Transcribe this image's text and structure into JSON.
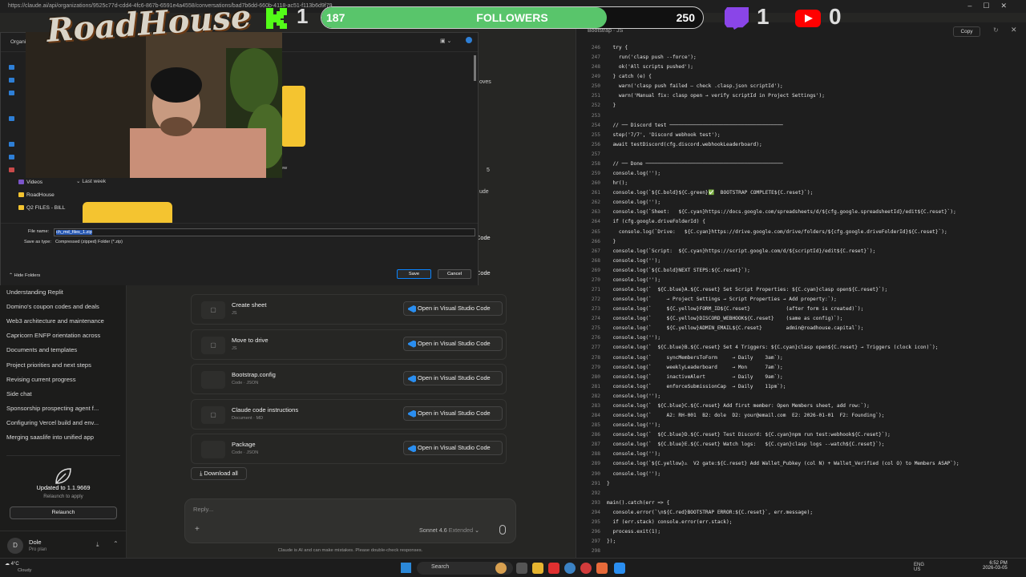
{
  "browser": {
    "url": "https://claude.ai/api/organizations/9525c77d-cdd4-4fc6-867b-6591e4a4558/conversations/bad7b6dd-660b-4118-ac51-f113b6d9f79"
  },
  "overlay": {
    "kick_count": "1",
    "followers_current": "187",
    "followers_label": "FOLLOWERS",
    "followers_goal": "250",
    "followers_progress": 0.748,
    "twitch_count": "1",
    "youtube_count": "0",
    "logo_text": "RoadHouse"
  },
  "dialog": {
    "organize": "Organi",
    "tree": [
      "Videos",
      "RoadHouse",
      "Q2 FILES - BILL"
    ],
    "last_week": "Last week",
    "partial_text_1": "oves",
    "partial_text_2": "ew",
    "partial_text_3": "5",
    "partial_text_4": "ude",
    "file_name_label": "File name:",
    "file_name_value": "ch_md_files_1.zip",
    "save_type_label": "Save as type:",
    "save_type_value": "Compressed (zipped) Folder (*.zip)",
    "hide_folders": "Hide Folders",
    "save": "Save",
    "cancel": "Cancel"
  },
  "sidebar": {
    "chats": [
      "Understanding Replit",
      "Domino's coupon codes and deals",
      "Web3 architecture and maintenance",
      "Capricorn ENFP orientation across",
      "Documents and templates",
      "Project priorities and next steps",
      "Revising current progress",
      "Side chat",
      "Sponsorship prospecting agent f...",
      "Configuring Vercel build and env...",
      "Merging saaslife into unified app"
    ],
    "update_title": "Updated to 1.1.9669",
    "update_sub": "Relaunch to apply",
    "relaunch": "Relaunch",
    "user_initial": "D",
    "user_name": "Dole",
    "user_plan": "Pro plan"
  },
  "main": {
    "partial_code_label": "Code",
    "files": [
      {
        "name": "Create sheet",
        "meta": "JS"
      },
      {
        "name": "Move to drive",
        "meta": "JS"
      },
      {
        "name": "Bootstrap.config",
        "meta": "Code · JSON"
      },
      {
        "name": "Claude code instructions",
        "meta": "Document · MD"
      },
      {
        "name": "Package",
        "meta": "Code · JSON"
      }
    ],
    "open_vs": "Open in Visual Studio Code",
    "download_all": "Download all",
    "reply_placeholder": "Reply...",
    "model": "Sonnet 4.6",
    "model_mode": "Extended",
    "disclaimer": "Claude is AI and can make mistakes. Please double-check responses."
  },
  "artifact": {
    "title": "Bootstrap · JS",
    "copy": "Copy",
    "lines": [
      {
        "n": "246",
        "t": "  try {"
      },
      {
        "n": "247",
        "t": "    run('clasp push --force');"
      },
      {
        "n": "248",
        "t": "    ok('All scripts pushed');"
      },
      {
        "n": "249",
        "t": "  } catch (e) {"
      },
      {
        "n": "250",
        "t": "    warn('clasp push failed — check .clasp.json scriptId');"
      },
      {
        "n": "251",
        "t": "    warn('Manual fix: clasp open → verify scriptId in Project Settings');"
      },
      {
        "n": "252",
        "t": "  }"
      },
      {
        "n": "253",
        "t": ""
      },
      {
        "n": "254",
        "t": "  // ── Discord test ──────────────────────────────────────"
      },
      {
        "n": "255",
        "t": "  step('7/7', 'Discord webhook test');"
      },
      {
        "n": "256",
        "t": "  await testDiscord(cfg.discord.webhookLeaderboard);"
      },
      {
        "n": "257",
        "t": ""
      },
      {
        "n": "258",
        "t": "  // ── Done ──────────────────────────────────────────────"
      },
      {
        "n": "259",
        "t": "  console.log('');"
      },
      {
        "n": "260",
        "t": "  hr();"
      },
      {
        "n": "261",
        "t": "  console.log(`${C.bold}${C.green}✅  BOOTSTRAP COMPLETE${C.reset}`);"
      },
      {
        "n": "262",
        "t": "  console.log('');"
      },
      {
        "n": "263",
        "t": "  console.log(`Sheet:   ${C.cyan}https://docs.google.com/spreadsheets/d/${cfg.google.spreadsheetId}/edit${C.reset}`);"
      },
      {
        "n": "264",
        "t": "  if (cfg.google.driveFolderId) {"
      },
      {
        "n": "265",
        "t": "    console.log(`Drive:   ${C.cyan}https://drive.google.com/drive/folders/${cfg.google.driveFolderId}${C.reset}`);"
      },
      {
        "n": "266",
        "t": "  }"
      },
      {
        "n": "267",
        "t": "  console.log(`Script:  ${C.cyan}https://script.google.com/d/${scriptId}/edit${C.reset}`);"
      },
      {
        "n": "268",
        "t": "  console.log('');"
      },
      {
        "n": "269",
        "t": "  console.log(`${C.bold}NEXT STEPS:${C.reset}`);"
      },
      {
        "n": "270",
        "t": "  console.log('');"
      },
      {
        "n": "271",
        "t": "  console.log(`  ${C.blue}A.${C.reset} Set Script Properties: ${C.cyan}clasp open${C.reset}`);"
      },
      {
        "n": "272",
        "t": "  console.log(`     → Project Settings → Script Properties → Add property:`);"
      },
      {
        "n": "273",
        "t": "  console.log(`     ${C.yellow}FORM_ID${C.reset}            (after form is created)`);"
      },
      {
        "n": "274",
        "t": "  console.log(`     ${C.yellow}DISCORD_WEBHOOK${C.reset}    (same as config)`);"
      },
      {
        "n": "275",
        "t": "  console.log(`     ${C.yellow}ADMIN_EMAIL${C.reset}        admin@roadhouse.capital`);"
      },
      {
        "n": "276",
        "t": "  console.log('');"
      },
      {
        "n": "277",
        "t": "  console.log(`  ${C.blue}B.${C.reset} Set 4 Triggers: ${C.cyan}clasp open${C.reset} → Triggers (clock icon)`);"
      },
      {
        "n": "278",
        "t": "  console.log(`     syncMembersToForm     → Daily    3am`);"
      },
      {
        "n": "279",
        "t": "  console.log(`     weeklyLeaderboard     → Mon      7am`);"
      },
      {
        "n": "280",
        "t": "  console.log(`     inactiveAlert         → Daily    9am`);"
      },
      {
        "n": "281",
        "t": "  console.log(`     enforceSubmissionCap  → Daily    11pm`);"
      },
      {
        "n": "282",
        "t": "  console.log('');"
      },
      {
        "n": "283",
        "t": "  console.log(`  ${C.blue}C.${C.reset} Add first member: Open Members sheet, add row:`);"
      },
      {
        "n": "284",
        "t": "  console.log(`     A2: RH-001  B2: dole  D2: your@email.com  E2: 2026-01-01  F2: Founding`);"
      },
      {
        "n": "285",
        "t": "  console.log('');"
      },
      {
        "n": "286",
        "t": "  console.log(`  ${C.blue}D.${C.reset} Test Discord: ${C.cyan}npm run test:webhook${C.reset}`);"
      },
      {
        "n": "287",
        "t": "  console.log(`  ${C.blue}E.${C.reset} Watch logs:   ${C.cyan}clasp logs --watch${C.reset}`);"
      },
      {
        "n": "288",
        "t": "  console.log('');"
      },
      {
        "n": "289",
        "t": "  console.log(`${C.yellow}⚠  V2 gate:${C.reset} Add Wallet_Pubkey (col N) + Wallet_Verified (col O) to Members ASAP`);"
      },
      {
        "n": "290",
        "t": "  console.log('');"
      },
      {
        "n": "291",
        "t": "}"
      },
      {
        "n": "292",
        "t": ""
      },
      {
        "n": "293",
        "t": "main().catch(err => {"
      },
      {
        "n": "294",
        "t": "  console.error(`\\n${C.red}BOOTSTRAP ERROR:${C.reset}`, err.message);"
      },
      {
        "n": "295",
        "t": "  if (err.stack) console.error(err.stack);"
      },
      {
        "n": "296",
        "t": "  process.exit(1);"
      },
      {
        "n": "297",
        "t": "});"
      },
      {
        "n": "298",
        "t": ""
      }
    ]
  },
  "taskbar": {
    "weather_temp": "4°C",
    "weather_desc": "Cloudy",
    "search": "Search",
    "lang": "ENG",
    "region": "US",
    "time": "6:52 PM",
    "date": "2026-03-05"
  }
}
